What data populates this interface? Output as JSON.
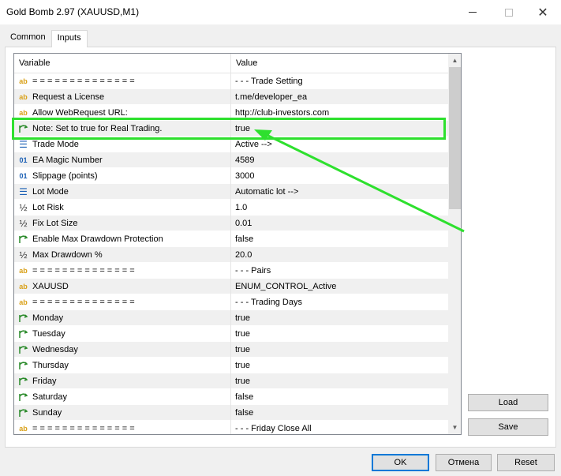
{
  "window": {
    "title": "Gold Bomb 2.97 (XAUUSD,M1)"
  },
  "tabs": [
    {
      "label": "Common"
    },
    {
      "label": "Inputs"
    }
  ],
  "grid": {
    "header": {
      "variable": "Variable",
      "value": "Value"
    },
    "rows": [
      {
        "icon": "ab",
        "variable": "= = = = = = = = = = = = = =",
        "value": "- - - Trade Setting"
      },
      {
        "icon": "ab",
        "variable": "Request a License",
        "value": "t.me/developer_ea"
      },
      {
        "icon": "ab",
        "variable": "Allow WebRequest URL:",
        "value": "http://club-investors.com"
      },
      {
        "icon": "bool",
        "variable": "Note: Set to true for Real Trading.",
        "value": "true"
      },
      {
        "icon": "enum",
        "variable": "Trade Mode",
        "value": "Active -->"
      },
      {
        "icon": "int",
        "variable": "EA Magic Number",
        "value": "4589"
      },
      {
        "icon": "int",
        "variable": "Slippage (points)",
        "value": "3000"
      },
      {
        "icon": "enum",
        "variable": "Lot Mode",
        "value": "Automatic lot -->"
      },
      {
        "icon": "double",
        "variable": "Lot Risk",
        "value": "1.0"
      },
      {
        "icon": "double",
        "variable": "Fix Lot Size",
        "value": "0.01"
      },
      {
        "icon": "bool",
        "variable": "Enable Max Drawdown Protection",
        "value": "false"
      },
      {
        "icon": "double",
        "variable": "Max Drawdown %",
        "value": "20.0"
      },
      {
        "icon": "ab",
        "variable": "= = = = = = = = = = = = = =",
        "value": "- - - Pairs"
      },
      {
        "icon": "ab",
        "variable": "XAUUSD",
        "value": "ENUM_CONTROL_Active"
      },
      {
        "icon": "ab",
        "variable": "= = = = = = = = = = = = = =",
        "value": "- - - Trading Days"
      },
      {
        "icon": "bool",
        "variable": "Monday",
        "value": "true"
      },
      {
        "icon": "bool",
        "variable": "Tuesday",
        "value": "true"
      },
      {
        "icon": "bool",
        "variable": "Wednesday",
        "value": "true"
      },
      {
        "icon": "bool",
        "variable": "Thursday",
        "value": "true"
      },
      {
        "icon": "bool",
        "variable": "Friday",
        "value": "true"
      },
      {
        "icon": "bool",
        "variable": "Saturday",
        "value": "false"
      },
      {
        "icon": "bool",
        "variable": "Sunday",
        "value": "false"
      },
      {
        "icon": "ab",
        "variable": "= = = = = = = = = = = = = =",
        "value": "- - - Friday Close All"
      }
    ]
  },
  "buttons": {
    "load": "Load",
    "save": "Save",
    "ok": "OK",
    "cancel": "Отмена",
    "reset": "Reset"
  },
  "colors": {
    "highlight": "#2ee02e",
    "accent": "#0078d7"
  }
}
